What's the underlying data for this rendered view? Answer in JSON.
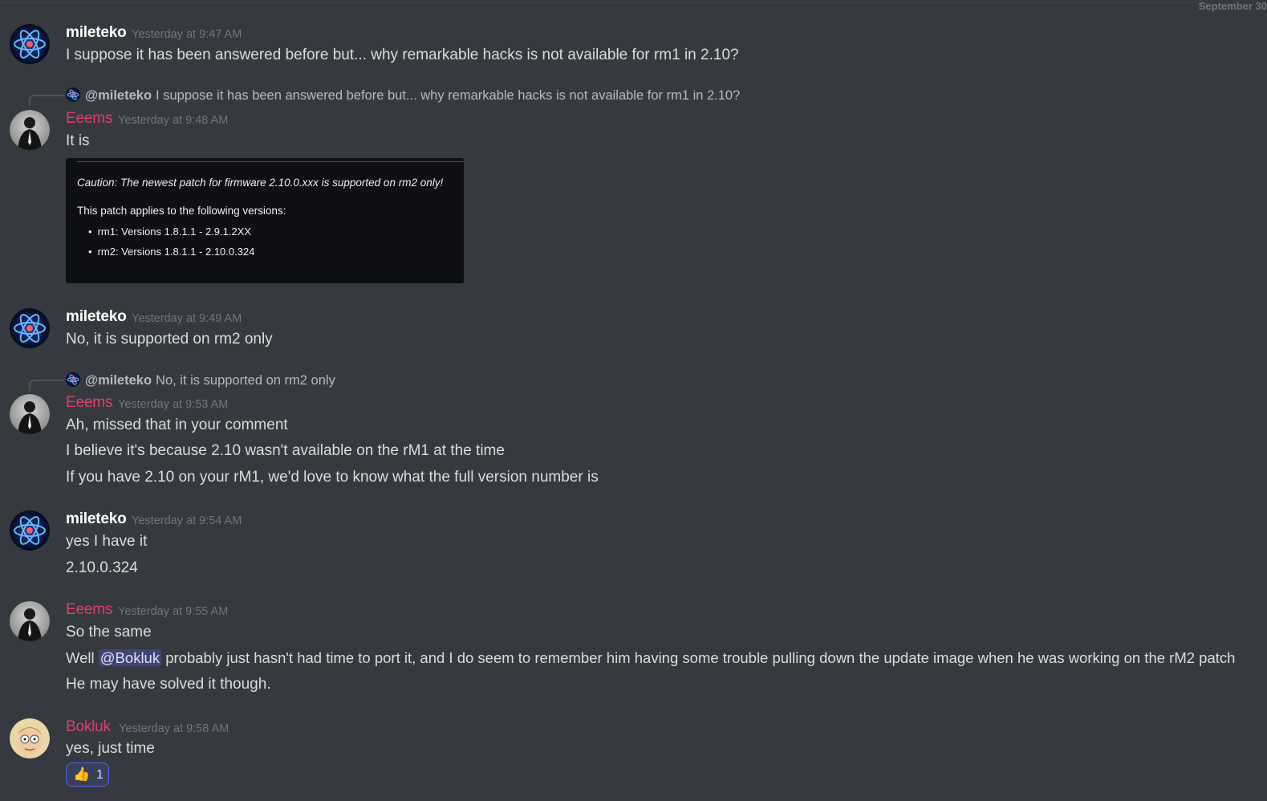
{
  "date_divider": "September 30",
  "colors": {
    "background": "#36393f",
    "author_pink": "#e0406e",
    "mention_bg": "rgba(88,101,242,0.3)"
  },
  "messages": [
    {
      "author": "mileteko",
      "timestamp": "Yesterday at 9:47 AM",
      "avatar_icon": "atom-avatar-icon",
      "lines": [
        "I suppose it has been answered before but... why remarkable hacks is not available for rm1 in 2.10?"
      ]
    },
    {
      "author": "Eeems",
      "timestamp": "Yesterday at 9:48 AM",
      "avatar_icon": "suit-figure-avatar-icon",
      "reply": {
        "mention": "@mileteko",
        "text": "I suppose it has been answered before but... why remarkable hacks is not available for rm1 in 2.10?"
      },
      "lines": [
        "It is"
      ],
      "embed": {
        "caution": "Caution: The newest patch for firmware 2.10.0.xxx is supported on rm2 only!",
        "applies": "This patch applies to the following versions:",
        "versions": [
          "rm1: Versions 1.8.1.1 - 2.9.1.2XX",
          "rm2: Versions 1.8.1.1 - 2.10.0.324"
        ]
      }
    },
    {
      "author": "mileteko",
      "timestamp": "Yesterday at 9:49 AM",
      "avatar_icon": "atom-avatar-icon",
      "lines": [
        "No, it is supported on rm2 only"
      ]
    },
    {
      "author": "Eeems",
      "timestamp": "Yesterday at 9:53 AM",
      "avatar_icon": "suit-figure-avatar-icon",
      "reply": {
        "mention": "@mileteko",
        "text": "No, it is supported on rm2 only"
      },
      "lines": [
        "Ah, missed that in your comment",
        "I believe it's because 2.10 wasn't available on the rM1 at the time",
        "If you have 2.10 on your rM1, we'd love to know what the full version number is"
      ]
    },
    {
      "author": "mileteko",
      "timestamp": "Yesterday at 9:54 AM",
      "avatar_icon": "atom-avatar-icon",
      "lines": [
        "yes I have it",
        "2.10.0.324"
      ]
    },
    {
      "author": "Eeems",
      "timestamp": "Yesterday at 9:55 AM",
      "avatar_icon": "suit-figure-avatar-icon",
      "lines": [
        "So the same"
      ],
      "line_with_mention": {
        "before": "Well ",
        "mention": "@Bokluk",
        "after": " probably just hasn't had time to port it, and I do seem to remember him having some trouble pulling down the update image when he was working on the rM2 patch"
      },
      "lines_after": [
        "He may have solved it though."
      ]
    },
    {
      "author": "Bokluk",
      "timestamp": "Yesterday at 9:58 AM",
      "avatar_icon": "cartoon-face-avatar-icon",
      "lines": [
        "yes, just time"
      ],
      "reaction": {
        "emoji_icon": "thumbs-up-icon",
        "count": "1"
      }
    }
  ]
}
